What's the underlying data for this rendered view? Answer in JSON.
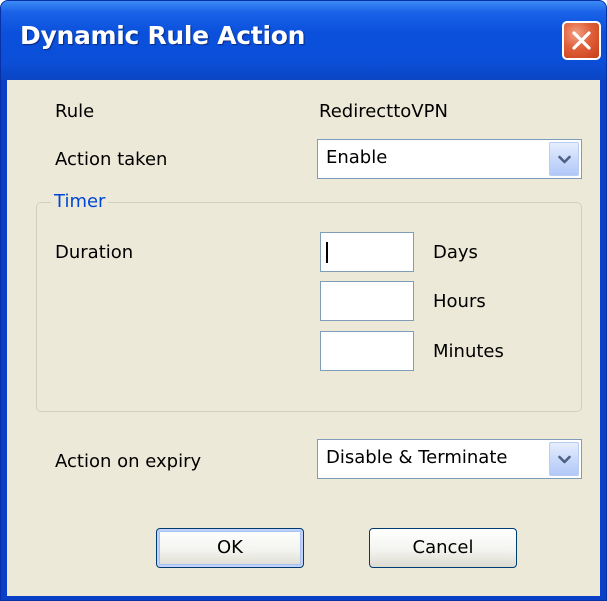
{
  "window": {
    "title": "Dynamic Rule Action"
  },
  "fields": {
    "rule_label": "Rule",
    "rule_value": "RedirecttoVPN",
    "action_taken_label": "Action taken",
    "action_taken_value": "Enable",
    "action_on_expiry_label": "Action on expiry",
    "action_on_expiry_value": "Disable & Terminate"
  },
  "timer": {
    "group_label": "Timer",
    "duration_label": "Duration",
    "days_label": "Days",
    "days_value": "",
    "hours_label": "Hours",
    "hours_value": "",
    "minutes_label": "Minutes",
    "minutes_value": ""
  },
  "buttons": {
    "ok_label": "OK",
    "cancel_label": "Cancel"
  },
  "icons": {
    "close": "close-icon",
    "dropdown": "chevron-down-icon"
  },
  "colors": {
    "titlebar": "#0a50dc",
    "close_button": "#e0603a",
    "dialog_background": "#ece9d8",
    "group_label": "#0046d5",
    "control_border": "#7f9db9"
  }
}
